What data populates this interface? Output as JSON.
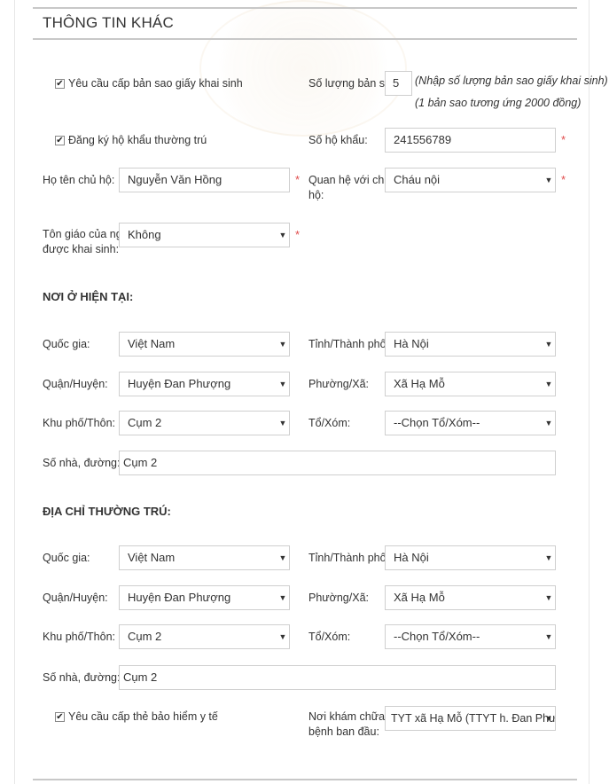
{
  "header": {
    "title": "THÔNG TIN KHÁC"
  },
  "copies": {
    "checkbox_label": "Yêu cầu cấp bản sao giấy khai sinh",
    "count_label": "Số lượng bản sao:",
    "count_value": "5",
    "note_line1": "(Nhập số lượng bản sao giấy khai sinh)",
    "note_line2": "(1 bản sao tương ứng 2000 đồng)"
  },
  "household": {
    "checkbox_label": "Đăng ký hộ khẩu thường trú",
    "number_label": "Số hộ khẩu:",
    "number_value": "241556789",
    "owner_label": "Họ tên chủ hộ:",
    "owner_value": "Nguyễn Văn Hồng",
    "relation_label_1": "Quan hệ với chủ",
    "relation_label_2": "hộ:",
    "relation_value": "Cháu nội",
    "religion_label_1": "Tôn giáo của người",
    "religion_label_2": "được khai sinh:",
    "religion_value": "Không",
    "required_mark": "*"
  },
  "current": {
    "heading": "NƠI Ở HIỆN TẠI:",
    "country_label": "Quốc gia:",
    "country": "Việt Nam",
    "province_label": "Tỉnh/Thành phố:",
    "province": "Hà Nội",
    "district_label": "Quận/Huyện:",
    "district": "Huyện Đan Phượng",
    "ward_label": "Phường/Xã:",
    "ward": "Xã Hạ Mỗ",
    "area_label": "Khu phố/Thôn:",
    "area": "Cụm 2",
    "group_label": "Tổ/Xóm:",
    "group": "--Chọn Tổ/Xóm--",
    "street_label": "Số nhà, đường:",
    "street": "Cụm 2"
  },
  "permanent": {
    "heading": "ĐỊA CHỈ THƯỜNG TRÚ:",
    "country_label": "Quốc gia:",
    "country": "Việt Nam",
    "province_label": "Tỉnh/Thành phố:",
    "province": "Hà Nội",
    "district_label": "Quận/Huyện:",
    "district": "Huyện Đan Phượng",
    "ward_label": "Phường/Xã:",
    "ward": "Xã Hạ Mỗ",
    "area_label": "Khu phố/Thôn:",
    "area": "Cụm 2",
    "group_label": "Tổ/Xóm:",
    "group": "--Chọn Tổ/Xóm--",
    "street_label": "Số nhà, đường:",
    "street": "Cụm 2"
  },
  "insurance": {
    "checkbox_label": "Yêu cầu cấp thẻ bảo hiểm y tế",
    "clinic_label_1": "Nơi khám chữa",
    "clinic_label_2": "bệnh ban đầu:",
    "clinic_value": "TYT xã Hạ Mỗ (TTYT h. Đan Phượng)"
  },
  "icons": {
    "checkbox": "checkmark-icon",
    "dropdown": "caret-down-icon"
  },
  "colors": {
    "required": "#e04b4b",
    "border": "#cfcfcf",
    "rule": "#c8c8c8"
  }
}
